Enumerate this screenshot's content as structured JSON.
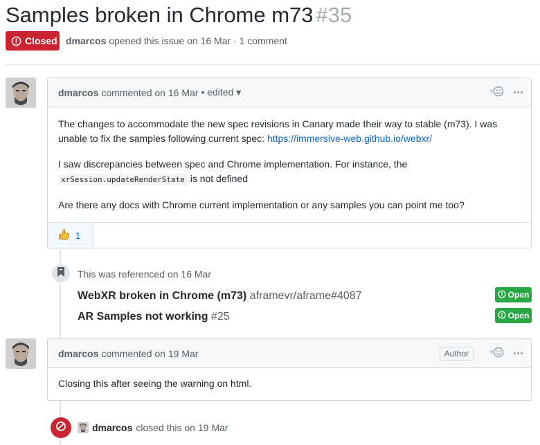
{
  "issue": {
    "title": "Samples broken in Chrome m73",
    "number": "#35",
    "state": "Closed",
    "author": "dmarcos",
    "opened_text": "opened this issue on 16 Mar · 1 comment"
  },
  "comments": [
    {
      "author": "dmarcos",
      "meta": "commented on 16 Mar",
      "edited": "• edited",
      "paragraph1_text": "The changes to accommodate the new spec revisions in Canary made their way to stable (m73). I was unable to fix the samples following current spec: ",
      "paragraph1_link": "https://immersive-web.github.io/webxr/",
      "paragraph2_text": "I saw discrepancies between spec and Chrome implementation. For instance, the ",
      "paragraph2_code": "xrSession.updateRenderState",
      "paragraph2_tail": " is not defined",
      "paragraph3_text": "Are there any docs with Chrome current implementation or any samples you can point me too?",
      "reaction_count": "1"
    },
    {
      "author": "dmarcos",
      "meta": "commented on 19 Mar",
      "author_badge": "Author",
      "body": "Closing this after seeing the warning on html."
    }
  ],
  "reference": {
    "text": "This was referenced on 16 Mar",
    "items": [
      {
        "title": "WebXR broken in Chrome (m73)",
        "ref": "aframevr/aframe#4087",
        "state": "Open"
      },
      {
        "title": "AR Samples not working",
        "ref": "#25",
        "state": "Open"
      }
    ]
  },
  "closed_event": {
    "actor": "dmarcos",
    "text": "closed this on 19 Mar"
  },
  "colors": {
    "closed_red": "#cb2431",
    "open_green": "#28a745",
    "link_blue": "#0366d6"
  },
  "icons": [
    "issue-closed-icon",
    "smiley-icon",
    "kebab-icon",
    "thumbs-up-icon",
    "bookmark-icon",
    "circle-slash-icon",
    "issue-opened-icon"
  ]
}
